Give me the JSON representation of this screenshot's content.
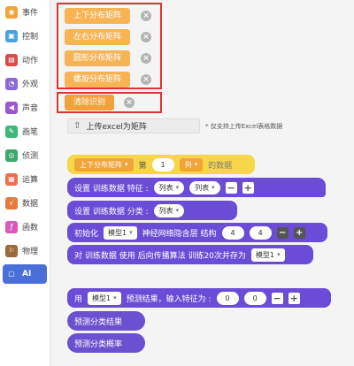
{
  "sidebar": {
    "items": [
      {
        "label": "事件",
        "icon": "toggle-icon",
        "color": "#f0a43a",
        "glyph": "◉"
      },
      {
        "label": "控制",
        "icon": "gamepad-icon",
        "color": "#4aa3df",
        "glyph": "▣"
      },
      {
        "label": "动作",
        "icon": "motion-icon",
        "color": "#d94a4a",
        "glyph": "▤"
      },
      {
        "label": "外观",
        "icon": "appearance-icon",
        "color": "#8a6ad8",
        "glyph": "◔"
      },
      {
        "label": "声音",
        "icon": "speaker-icon",
        "color": "#9b59d0",
        "glyph": "◀"
      },
      {
        "label": "画笔",
        "icon": "pen-icon",
        "color": "#3db87a",
        "glyph": "✎"
      },
      {
        "label": "侦测",
        "icon": "detect-icon",
        "color": "#3aa86a",
        "glyph": "◎"
      },
      {
        "label": "运算",
        "icon": "calculator-icon",
        "color": "#f06c4a",
        "glyph": "▦"
      },
      {
        "label": "数据",
        "icon": "chart-icon",
        "color": "#e77a3a",
        "glyph": "√"
      },
      {
        "label": "函数",
        "icon": "function-icon",
        "color": "#d85ab8",
        "glyph": "ƒ"
      },
      {
        "label": "物理",
        "icon": "physics-icon",
        "color": "#9a6a3a",
        "glyph": "⚐"
      },
      {
        "label": "AI",
        "icon": "ai-icon",
        "color": "#4a6fd8",
        "glyph": "▢",
        "active": true
      }
    ]
  },
  "workspace": {
    "matrix_buttons": [
      "上下分布矩阵",
      "左右分布矩阵",
      "圆形分布矩阵",
      "螺旋分布矩阵"
    ],
    "clear_button": "清除识别",
    "upload": {
      "label": "上传excel为矩阵",
      "note": "* 仅支持上传Excel表格数据"
    },
    "row_block": {
      "matrix_value": "上下分布矩阵",
      "text_a": "第",
      "row_num": "1",
      "col_value": "列",
      "text_b": "的数据"
    },
    "feature_block": {
      "label": "设置 训练数据 特征 :",
      "field1": "列表",
      "field2": "列表"
    },
    "class_block": {
      "label": "设置 训练数据 分类 :",
      "field1": "列表"
    },
    "init_block": {
      "label_a": "初始化",
      "model": "模型1",
      "label_b": "神经网络隐含层 结构",
      "val1": "4",
      "val2": "4"
    },
    "train_block": {
      "label": "对 训练数据 使用 后向传播算法 训练20次并存为",
      "model": "模型1"
    },
    "predict_block": {
      "label_a": "用",
      "model": "模型1",
      "label_b": "预测结果，输入特征为 :",
      "val1": "0",
      "val2": "0"
    },
    "result_block": "预测分类结果",
    "prob_block": "预测分类概率"
  },
  "colors": {
    "accent": "#4a6fd8",
    "block_orange": "#f7b455",
    "block_yellow": "#f8d64a",
    "block_purple": "#6a4cd6",
    "frame_red": "#e03434"
  }
}
